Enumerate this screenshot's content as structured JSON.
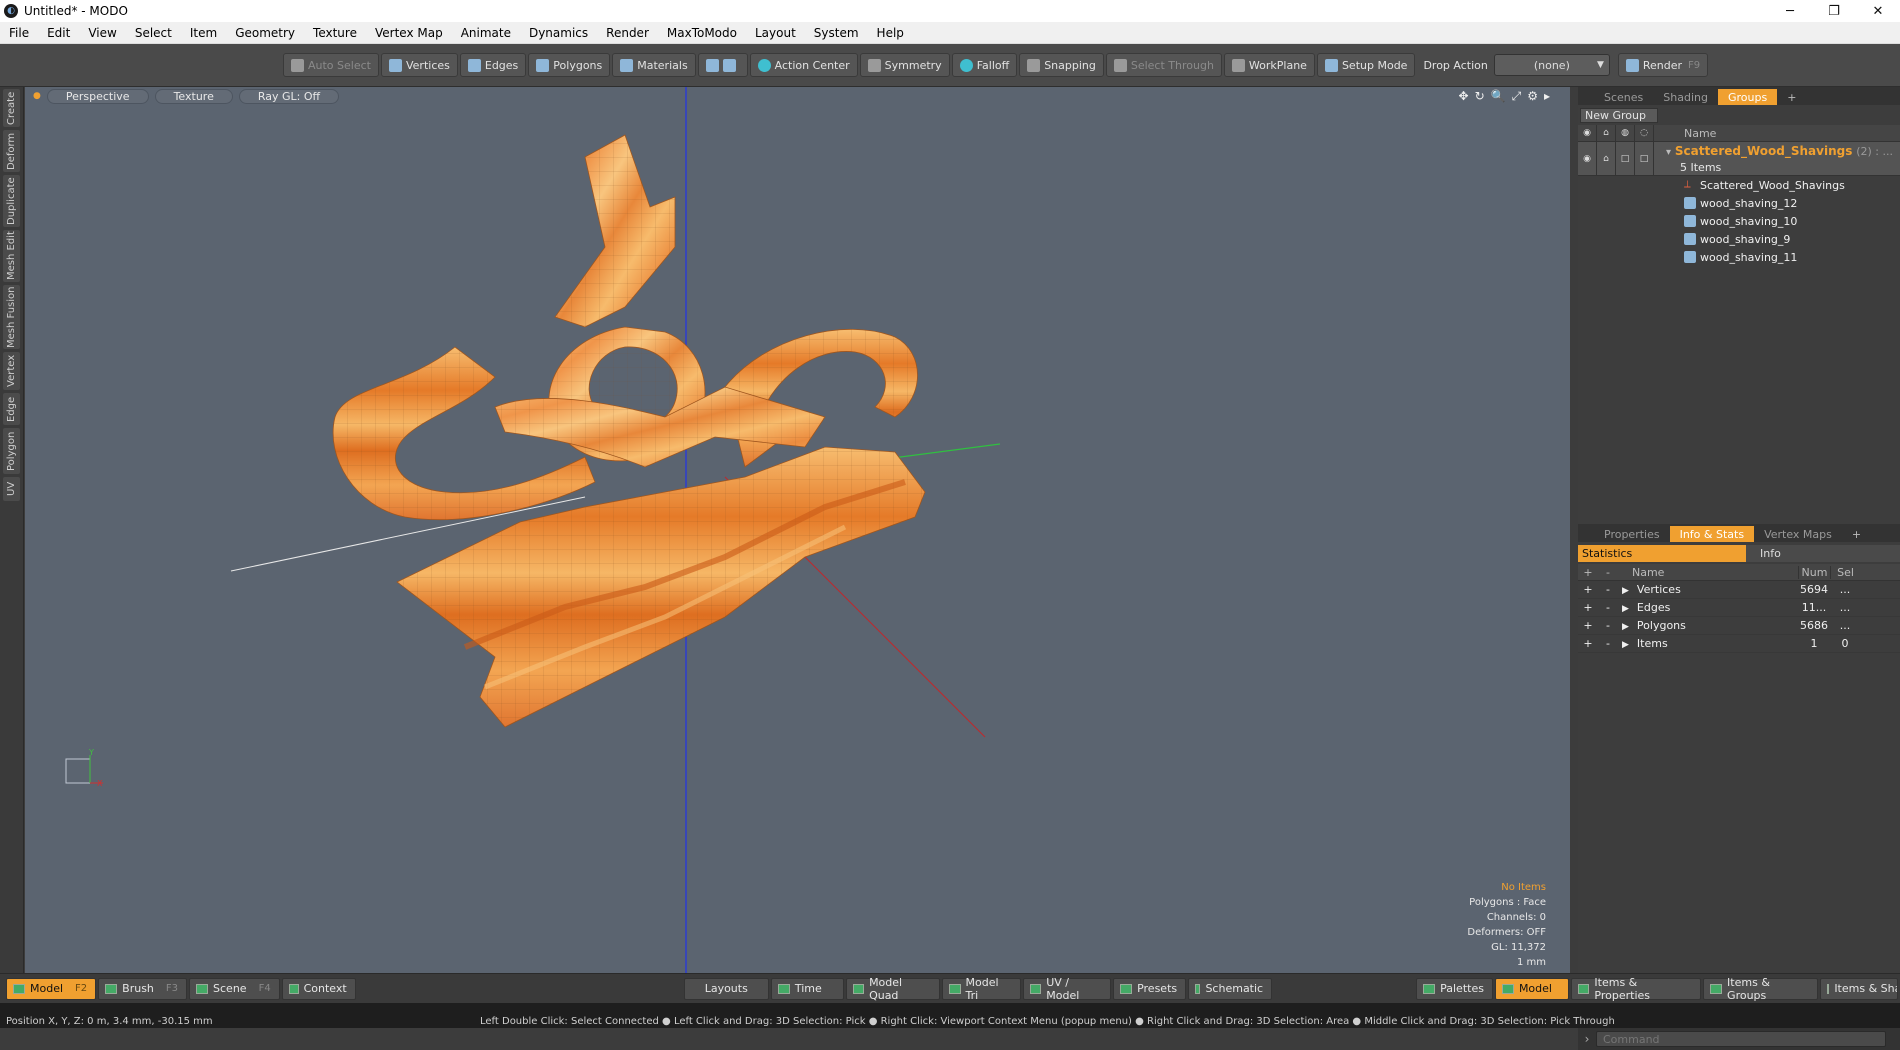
{
  "window": {
    "title": "Untitled* - MODO",
    "app_icon": "modo-logo",
    "controls": [
      "─",
      "❐",
      "✕"
    ]
  },
  "menu": [
    "File",
    "Edit",
    "View",
    "Select",
    "Item",
    "Geometry",
    "Texture",
    "Vertex Map",
    "Animate",
    "Dynamics",
    "Render",
    "MaxToModo",
    "Layout",
    "System",
    "Help"
  ],
  "toolbar": {
    "auto_select": "Auto Select",
    "vertices": "Vertices",
    "edges": "Edges",
    "polygons": "Polygons",
    "materials": "Materials",
    "action_center": "Action Center",
    "symmetry": "Symmetry",
    "falloff": "Falloff",
    "snapping": "Snapping",
    "select_through": "Select Through",
    "workplane": "WorkPlane",
    "setup_mode": "Setup Mode",
    "drop_action_label": "Drop Action",
    "drop_action_value": "(none)",
    "render": "Render",
    "render_key": "F9"
  },
  "left_tabs": [
    "Create",
    "Deform",
    "Duplicate",
    "Mesh Edit",
    "Mesh Fusion",
    "Vertex",
    "Edge",
    "Polygon",
    "UV"
  ],
  "viewport": {
    "view_mode": "Perspective",
    "shading": "Texture",
    "raygl": "Ray GL: Off",
    "stats": {
      "no_items": "No Items",
      "polygons": "Polygons : Face",
      "channels": "Channels: 0",
      "deformers": "Deformers: OFF",
      "gl": "GL: 11,372",
      "unit": "1 mm"
    },
    "axis_gizmo_y": "Y",
    "axis_gizmo_x": "X"
  },
  "groups_panel": {
    "tabs": [
      "Scenes",
      "Shading",
      "Groups",
      "+"
    ],
    "active_tab": "Groups",
    "new_group": "New Group",
    "name_header": "Name",
    "group": {
      "name": "Scattered_Wood_Shavings",
      "count_suffix": "(2) : ...",
      "items_label": "5 Items"
    },
    "children": [
      {
        "name": "Scattered_Wood_Shavings",
        "icon": "locator-icon"
      },
      {
        "name": "wood_shaving_12",
        "icon": "mesh-icon"
      },
      {
        "name": "wood_shaving_10",
        "icon": "mesh-icon"
      },
      {
        "name": "wood_shaving_9",
        "icon": "mesh-icon"
      },
      {
        "name": "wood_shaving_11",
        "icon": "mesh-icon"
      }
    ]
  },
  "info_panel": {
    "tabs": [
      "Properties",
      "Info & Stats",
      "Vertex Maps",
      "+"
    ],
    "active_tab": "Info & Stats",
    "subtabs": [
      "Statistics",
      "Info"
    ],
    "headers": {
      "name": "Name",
      "num": "Num",
      "sel": "Sel"
    },
    "rows": [
      {
        "name": "Vertices",
        "num": "5694",
        "sel": "..."
      },
      {
        "name": "Edges",
        "num": "11...",
        "sel": "..."
      },
      {
        "name": "Polygons",
        "num": "5686",
        "sel": "..."
      },
      {
        "name": "Items",
        "num": "1",
        "sel": "0"
      }
    ],
    "command_placeholder": "Command"
  },
  "bottom_bar": {
    "left": [
      {
        "label": "Model",
        "key": "F2",
        "active": true
      },
      {
        "label": "Brush",
        "key": "F3"
      },
      {
        "label": "Scene",
        "key": "F4"
      },
      {
        "label": "Context",
        "key": ""
      }
    ],
    "center": [
      "Layouts",
      "Time",
      "Model Quad",
      "Model Tri",
      "UV / Model",
      "Presets",
      "Schematic"
    ],
    "right": [
      "Palettes",
      "Model",
      "Items & Properties",
      "Items & Groups",
      "Items & Shading"
    ]
  },
  "status": {
    "position": "Position X, Y, Z:  0 m, 3.4 mm, -30.15 mm",
    "hints": "Left Double Click: Select Connected ● Left Click and Drag: 3D Selection: Pick ● Right Click: Viewport Context Menu (popup menu) ● Right Click and Drag: 3D Selection: Area ● Middle Click and Drag: 3D Selection: Pick Through"
  },
  "colors": {
    "accent": "#f0a030",
    "viewport_bg": "#5b6470",
    "wood_light": "#f6b766",
    "wood_dark": "#e57a28"
  }
}
